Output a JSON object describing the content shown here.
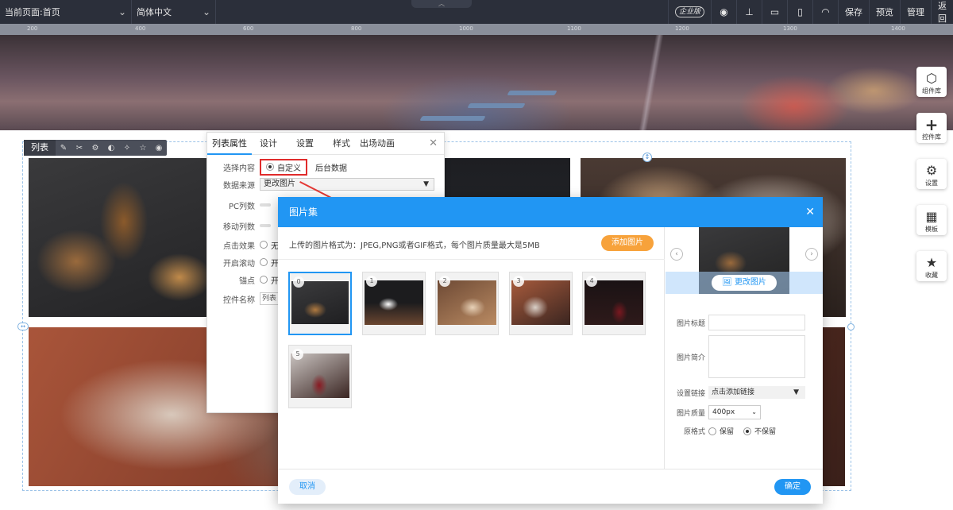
{
  "topbar": {
    "current_page": "当前页面:首页",
    "language": "简体中文",
    "enterprise_badge": "企业版",
    "save": "保存",
    "preview": "预览",
    "manage": "管理",
    "back": "返回"
  },
  "ruler": {
    "ticks": [
      "200",
      "400",
      "600",
      "800",
      "1000",
      "1100",
      "1200",
      "1300",
      "1400"
    ]
  },
  "side_tools": [
    {
      "label": "组件库",
      "icon": "cube-icon"
    },
    {
      "label": "控件库",
      "icon": "plus-icon"
    },
    {
      "label": "设置",
      "icon": "gears-icon"
    },
    {
      "label": "模板",
      "icon": "grid-icon"
    },
    {
      "label": "收藏",
      "icon": "star-icon"
    }
  ],
  "list_toolbar": {
    "label": "列表"
  },
  "props_panel": {
    "tabs": [
      "列表属性",
      "设计",
      "设置",
      "样式",
      "出场动画"
    ],
    "select_content_label": "选择内容",
    "option_custom": "自定义",
    "option_backend": "后台数据",
    "data_source_label": "数据来源",
    "data_source_value": "更改图片",
    "pc_columns_label": "PC列数",
    "mobile_columns_label": "移动列数",
    "click_effect_label": "点击效果",
    "scroll_label": "开启滚动",
    "anchor_label": "锚点",
    "option_none": "无",
    "option_on": "开",
    "control_name_label": "控件名称",
    "control_name_value": "列表"
  },
  "dialog": {
    "title": "图片集",
    "tip": "上传的图片格式为：JPEG,PNG或者GIF格式，每个图片质量最大是5MB",
    "add_button": "添加图片",
    "thumbs": [
      "0",
      "1",
      "2",
      "3",
      "4",
      "5"
    ],
    "change_image": "更改图片",
    "image_title_label": "图片标题",
    "image_desc_label": "图片简介",
    "link_label": "设置链接",
    "link_value": "点击添加链接",
    "quality_label": "图片质量",
    "quality_value": "400px",
    "original_label": "原格式",
    "keep": "保留",
    "no_keep": "不保留",
    "cancel": "取消",
    "confirm": "确定"
  },
  "colors": {
    "accent": "#2196f3",
    "add_button": "#f7a23b",
    "highlight": "#e02b2b",
    "topbar": "#2b2f3a"
  }
}
